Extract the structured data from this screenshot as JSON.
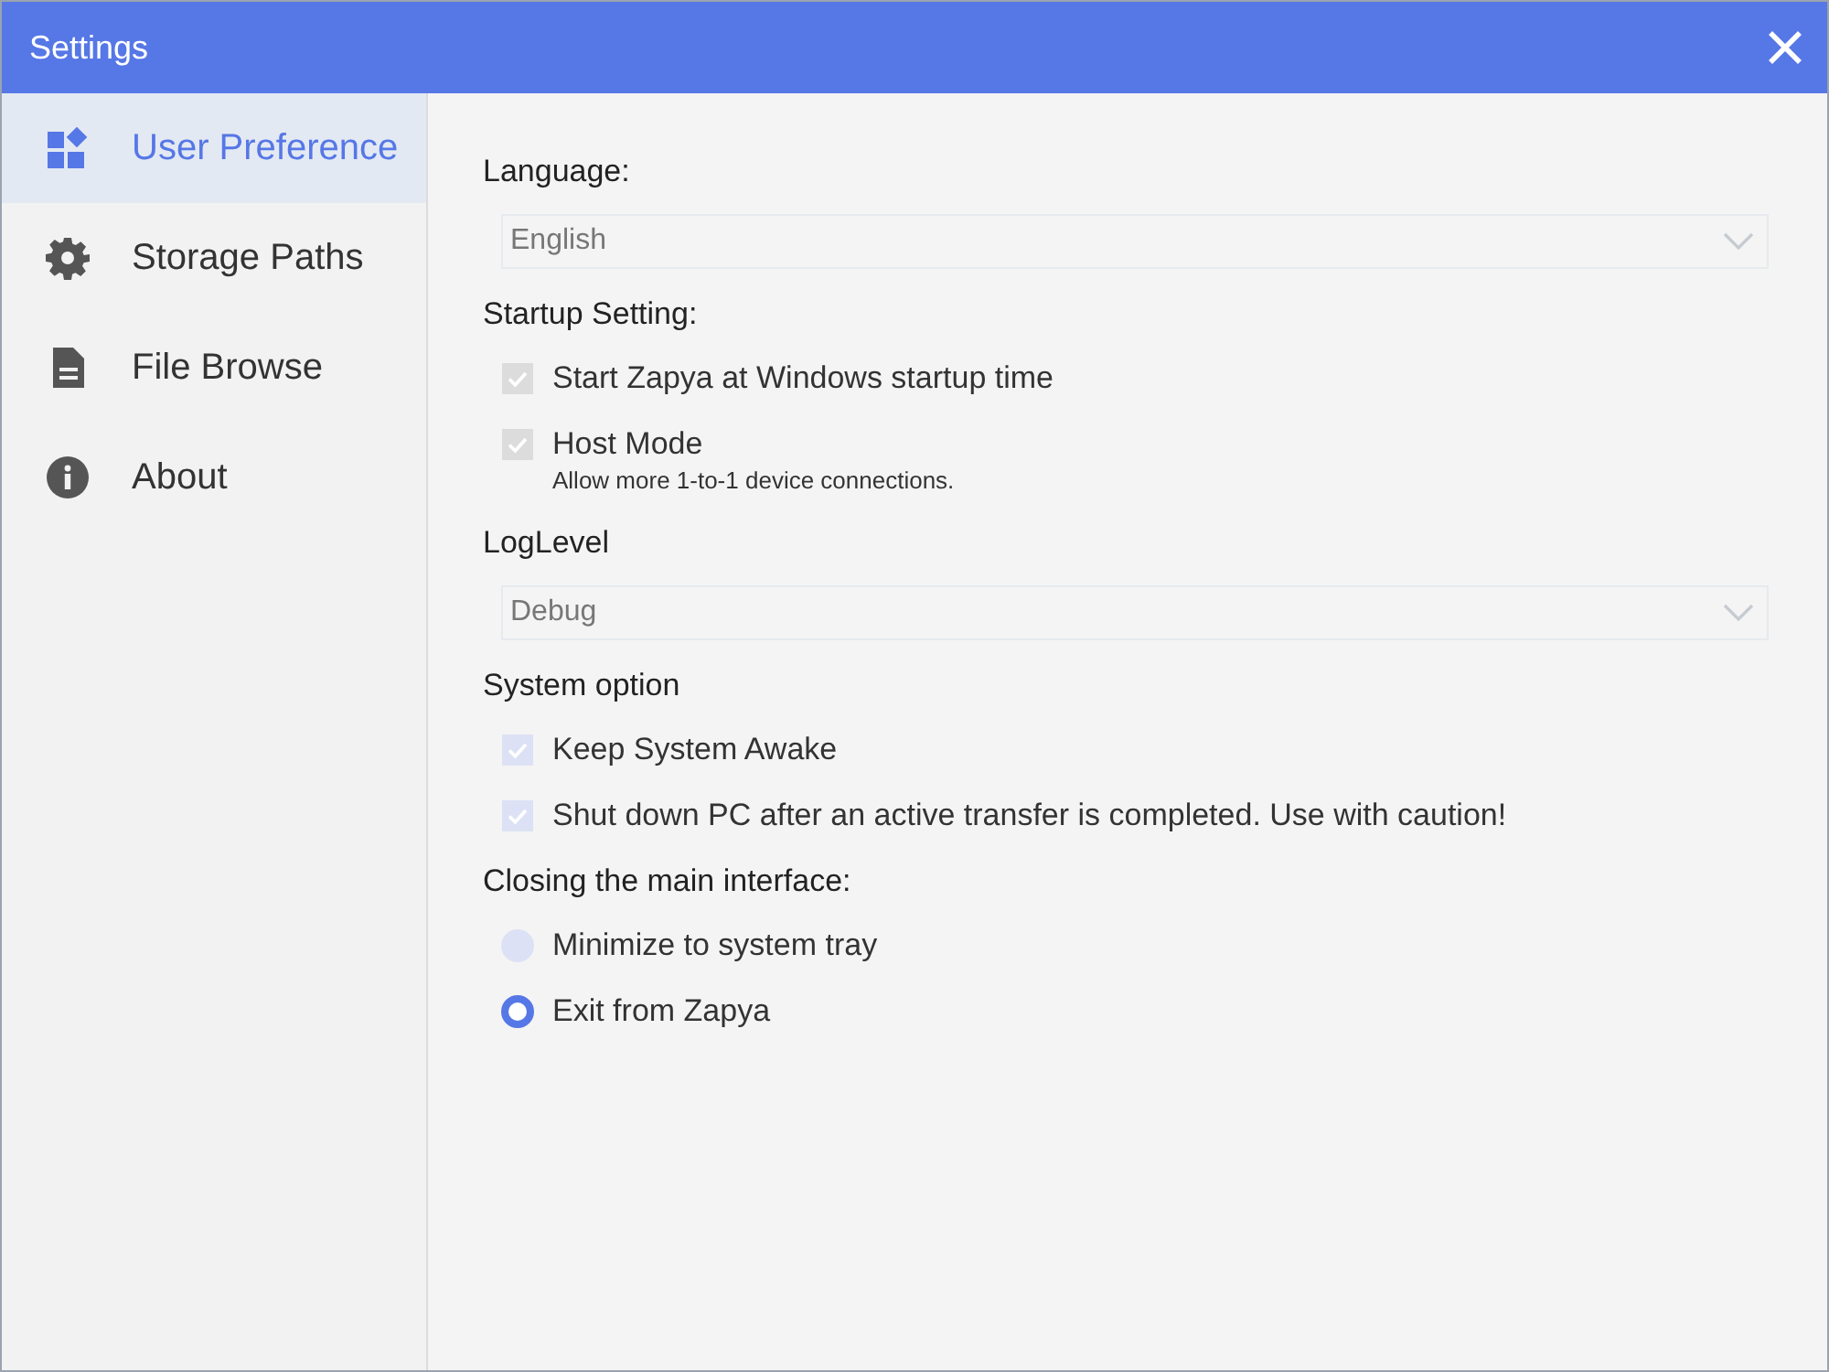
{
  "window": {
    "title": "Settings"
  },
  "sidebar": {
    "items": [
      {
        "label": "User Preference",
        "selected": true
      },
      {
        "label": "Storage Paths",
        "selected": false
      },
      {
        "label": "File Browse",
        "selected": false
      },
      {
        "label": "About",
        "selected": false
      }
    ]
  },
  "settings": [
    {
      "kind": "dropdown",
      "label": "Language:",
      "value": "English"
    },
    {
      "kind": "checkboxes",
      "label": "Startup Setting:",
      "options": [
        {
          "label": "Start Zapya at Windows startup time",
          "checked": true,
          "disabled": true
        },
        {
          "label": "Host Mode",
          "note": "Allow more 1-to-1 device connections.",
          "checked": true,
          "disabled": true
        }
      ]
    },
    {
      "kind": "dropdown",
      "label": "LogLevel",
      "value": "Debug"
    },
    {
      "kind": "checkboxes",
      "label": "System option",
      "options": [
        {
          "label": "Keep System Awake",
          "checked": true,
          "disabled": false
        },
        {
          "label": "Shut down PC after an active transfer is completed. Use with caution!",
          "checked": true,
          "disabled": false
        }
      ]
    },
    {
      "kind": "radios",
      "label": "Closing the main interface:",
      "options": [
        {
          "label": "Minimize to system tray",
          "selected": false
        },
        {
          "label": "Exit from Zapya",
          "selected": true
        }
      ]
    }
  ]
}
